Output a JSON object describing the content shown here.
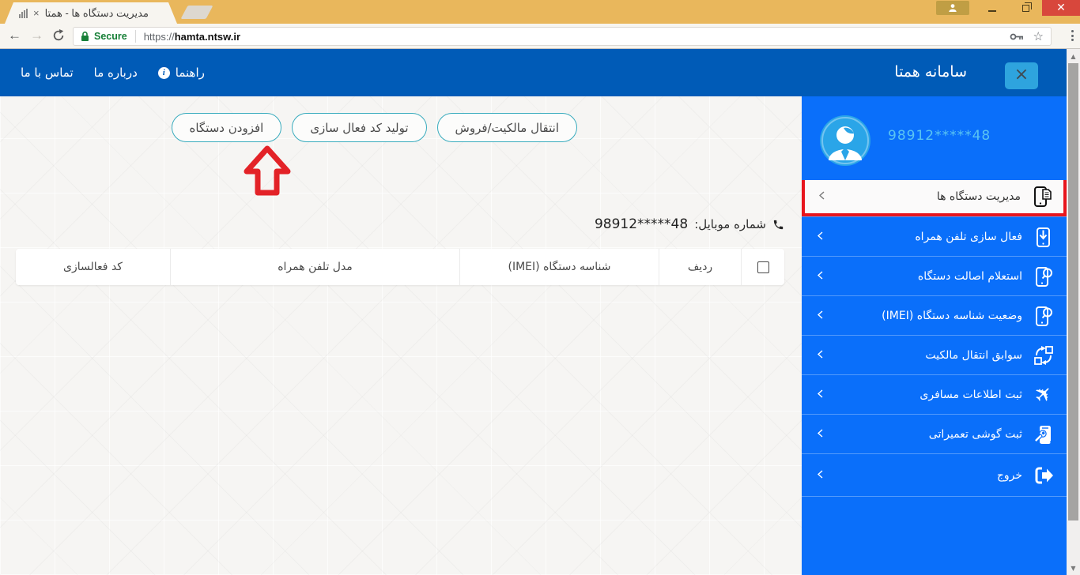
{
  "browser": {
    "tab_title": "مدیریت دستگاه ها - همتا",
    "secure_label": "Secure",
    "url_scheme": "https://",
    "url_domain": "hamta.ntsw.ir"
  },
  "header": {
    "brand": "سامانه همتا",
    "nav": [
      {
        "label": "تماس با ما"
      },
      {
        "label": "درباره ما"
      },
      {
        "label": "راهنما",
        "icon": "info-icon"
      }
    ]
  },
  "sidebar": {
    "phone_masked": "98912*****48",
    "items": [
      {
        "label": "مدیریت دستگاه ها",
        "icon": "sim-phone-icon",
        "active": true
      },
      {
        "label": "فعال سازی تلفن همراه",
        "icon": "phone-download-icon"
      },
      {
        "label": "استعلام اصالت دستگاه",
        "icon": "phone-search-icon"
      },
      {
        "label": "وضعیت شناسه دستگاه (IMEI)",
        "icon": "phone-search-icon"
      },
      {
        "label": "سوابق انتقال مالکیت",
        "icon": "transfer-icon"
      },
      {
        "label": "ثبت اطلاعات مسافری",
        "icon": "airplane-icon"
      },
      {
        "label": "ثبت گوشی تعمیراتی",
        "icon": "phone-repair-icon"
      },
      {
        "label": "خروج",
        "icon": "logout-icon"
      }
    ]
  },
  "main": {
    "actions": [
      {
        "label": "انتقال مالکیت/فروش"
      },
      {
        "label": "تولید کد فعال سازی"
      },
      {
        "label": "افزودن دستگاه",
        "annotated": true
      }
    ],
    "mobile": {
      "label": "شماره موبایل:",
      "value": "98912*****48"
    },
    "table": {
      "headers": [
        "ردیف",
        "شناسه دستگاه (IMEI)",
        "مدل تلفن همراه",
        "کد فعالسازی"
      ]
    }
  },
  "colors": {
    "titlebar_gold": "#e9b75c",
    "header_blue": "#005bb7",
    "sidebar_blue": "#0a6ffa",
    "highlight_red": "#e8151d",
    "annotation_red": "#e32227",
    "button_teal_border": "#3aacbe",
    "secure_green": "#188038",
    "phone_text_cyan": "#5ac4f2"
  }
}
